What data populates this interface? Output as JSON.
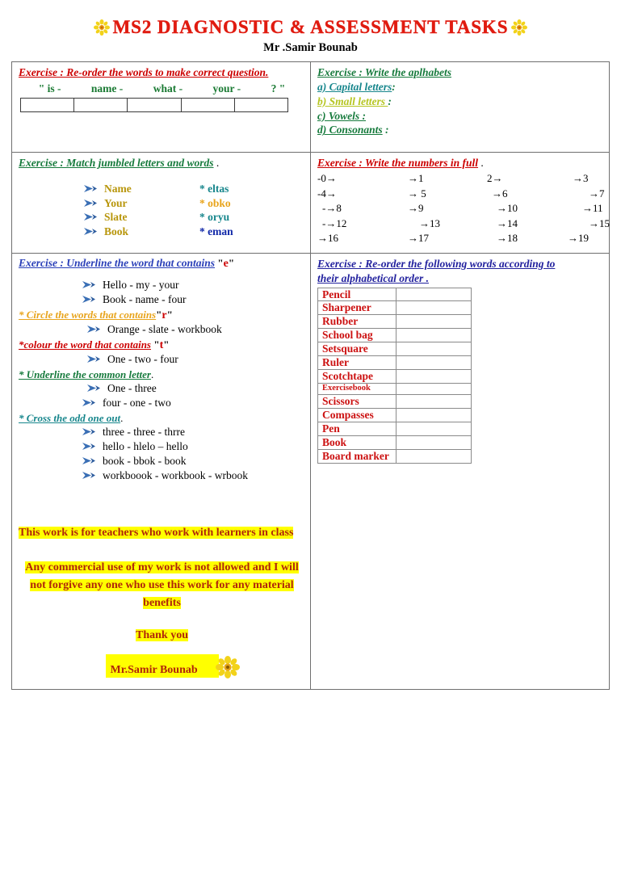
{
  "header": {
    "title": "MS2 DIAGNOSTIC & ASSESSMENT TASKS",
    "author": "Mr .Samir Bounab",
    "left_flower": "flower-icon",
    "right_flower": "flower-icon"
  },
  "ex1": {
    "heading": "Exercise :  Re-order the words to make correct question.",
    "words": [
      "\" is  -",
      "name -",
      "what -",
      "your -",
      "?    \""
    ],
    "answer_cells": [
      "",
      "",
      "",
      "",
      ""
    ]
  },
  "ex2": {
    "heading": "Exercise : Write the aplhabets",
    "lines": [
      {
        "label": "a) Capital letters",
        "suffix": ":"
      },
      {
        "label": "b) Small letters ",
        "suffix": ":"
      },
      {
        "label": "c) Vowels :",
        "suffix": ""
      },
      {
        "label": "d) Consonants",
        "suffix": " :"
      }
    ]
  },
  "ex3": {
    "heading": "Exercise : Match jumbled letters and words",
    "heading_suffix": " .",
    "pairs": [
      {
        "left": "Name",
        "right": "* eltas"
      },
      {
        "left": "Your",
        "right": "* obko"
      },
      {
        "left": "Slate",
        "right": "* oryu"
      },
      {
        "left": "Book",
        "right": "* eman"
      }
    ]
  },
  "ex4": {
    "heading": "Exercise : Write the numbers  in full",
    "heading_suffix": " .",
    "numbers": [
      "-0→",
      "→1",
      "2→",
      "→3",
      "-4→",
      "→ 5",
      "→6",
      "→7",
      "-→8",
      "→9",
      "→10",
      "→11",
      "-→12",
      "→13",
      "→14",
      "→15",
      "→16",
      "→17",
      "→18",
      "→19"
    ]
  },
  "ex5": {
    "heading": "Exercise  : Underline the word that contains",
    "heading_letter": "e",
    "items": [
      "Hello -  my  -  your",
      "Book  -   name  - four"
    ],
    "sub1": {
      "heading": "* Circle the words that contains",
      "letter": "r",
      "items": [
        "Orange  -    slate - workbook"
      ]
    },
    "sub2": {
      "heading": "*colour the word that contains",
      "letter": "t",
      "items": [
        "One -  two - four"
      ]
    },
    "sub3": {
      "heading": "* Underline the common letter",
      "heading_suffix": ".",
      "items": [
        "One  -   three",
        " four -  one   - two"
      ]
    },
    "sub4": {
      "heading": "* Cross the odd one out",
      "heading_suffix": ".",
      "items": [
        "three   -    three - thrre",
        "hello  - hlelo – hello",
        "book  - bbok  - book",
        "workboook -   workbook -  wrbook"
      ]
    }
  },
  "ex6": {
    "heading_line1": "Exercise : Re-order the following words according to",
    "heading_line2": "their alphabetical order .",
    "rows": [
      {
        "word": "Pencil",
        "answer": "",
        "small": false
      },
      {
        "word": "Sharpener",
        "answer": "",
        "small": false
      },
      {
        "word": "Rubber",
        "answer": "",
        "small": false
      },
      {
        "word": "School bag",
        "answer": "",
        "small": false
      },
      {
        "word": "Setsquare",
        "answer": "",
        "small": false
      },
      {
        "word": "Ruler",
        "answer": "",
        "small": false
      },
      {
        "word": "Scotchtape",
        "answer": "",
        "small": false
      },
      {
        "word": "Exercisebook",
        "answer": "",
        "small": true
      },
      {
        "word": "Scissors",
        "answer": "",
        "small": false
      },
      {
        "word": "Compasses",
        "answer": "",
        "small": false
      },
      {
        "word": "Pen",
        "answer": "",
        "small": false
      },
      {
        "word": "Book",
        "answer": "",
        "small": false
      },
      {
        "word": "Board marker",
        "answer": "",
        "small": false
      }
    ]
  },
  "notes": {
    "note1": "This work is for teachers who work with learners in class",
    "note2": "Any commercial use of my work is not allowed and I will not forgive any one who use this work for any material benefits",
    "note3": "Thank you",
    "signature": "Mr.Samir Bounab"
  },
  "colors": {
    "title_red": "#e01b10",
    "heading_red": "#cc0000",
    "green": "#1a7a33",
    "teal": "#17868c",
    "yellow_green": "#b5c520",
    "blue": "#2a3fb8",
    "orange": "#e8a41c",
    "olive": "#b8960c",
    "highlight": "#ffff00",
    "note_text": "#b0250a",
    "border": "#6f6f6f"
  }
}
